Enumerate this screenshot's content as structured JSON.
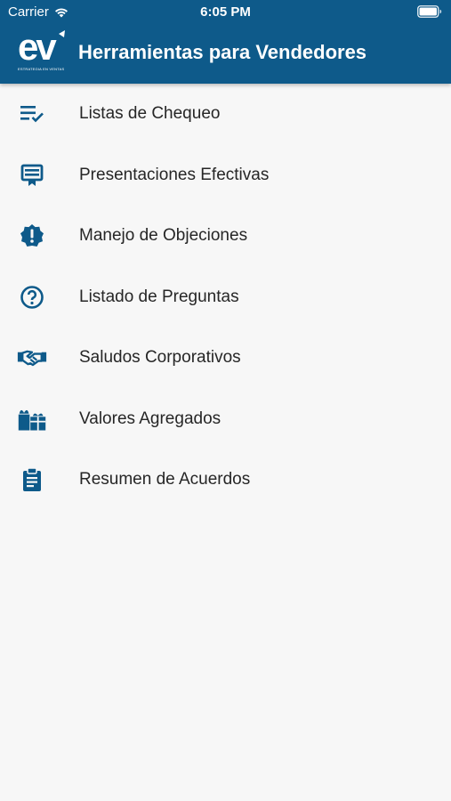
{
  "status_bar": {
    "carrier": "Carrier",
    "time": "6:05 PM"
  },
  "header": {
    "logo_text": "ev",
    "logo_subtext": "ESTRATEGIA EN VENTAS",
    "title": "Herramientas para Vendedores"
  },
  "colors": {
    "appbar": "#0e5a8a",
    "icon": "#0e5a8a",
    "background": "#f7f7f7",
    "text": "#262626"
  },
  "menu": {
    "items": [
      {
        "label": "Listas de Chequeo",
        "icon": "checklist-icon"
      },
      {
        "label": "Presentaciones Efectivas",
        "icon": "presentation-icon"
      },
      {
        "label": "Manejo de Objeciones",
        "icon": "alert-badge-icon"
      },
      {
        "label": "Listado de Preguntas",
        "icon": "help-circle-icon"
      },
      {
        "label": "Saludos Corporativos",
        "icon": "handshake-icon"
      },
      {
        "label": "Valores Agregados",
        "icon": "gifts-icon"
      },
      {
        "label": "Resumen de Acuerdos",
        "icon": "clipboard-icon"
      }
    ]
  }
}
